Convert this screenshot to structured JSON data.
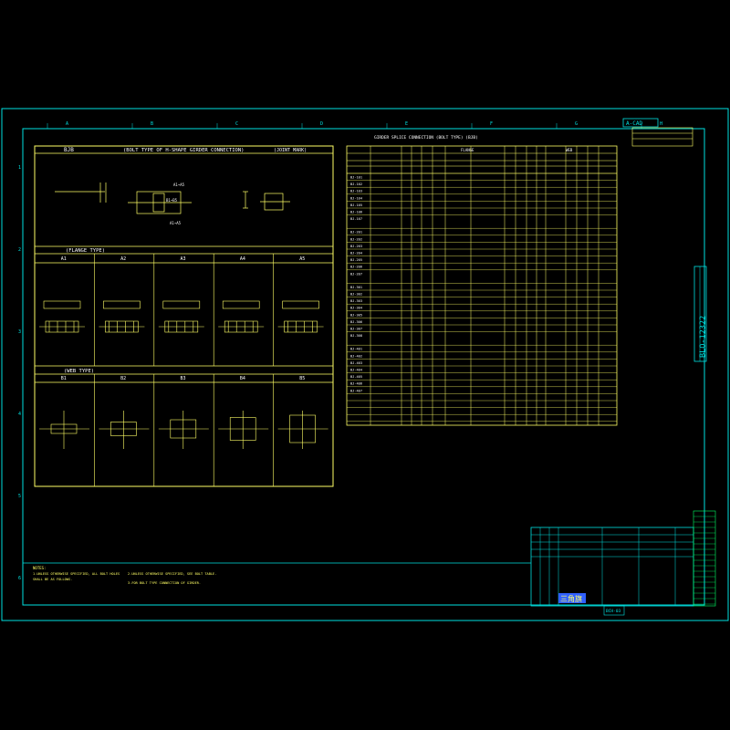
{
  "colors": {
    "background": "#000000",
    "frame": "#00e0e0",
    "drawing": "#ffff66",
    "white": "#ffffff",
    "green": "#00ff66",
    "magenta": "#ff00ff",
    "blue": "#3060ff"
  },
  "border": {
    "col_labels": [
      "A",
      "B",
      "C",
      "D",
      "E",
      "F",
      "G",
      "H"
    ],
    "row_labels": [
      "1",
      "2",
      "3",
      "4",
      "5",
      "6"
    ]
  },
  "left_sheet": {
    "header_code": "BJB",
    "header_title": "(BOLT TYPE OF H-SHAPE GIRDER CONNECTION)",
    "header_mark": "(JOINT MARK)",
    "flange_title": "(FLANGE TYPE)",
    "flange_cols": [
      "A1",
      "A2",
      "A3",
      "A4",
      "A5"
    ],
    "web_title": "(WEB TYPE)",
    "web_cols": [
      "B1",
      "B2",
      "B3",
      "B4",
      "B5"
    ],
    "callouts": [
      "A1~A5",
      "B1~B5",
      "A1~A5"
    ]
  },
  "table": {
    "title": "GIRDER SPLICE CONNECTION (BOLT TYPE) (BJB)",
    "group_headers": [
      "FLANGE",
      "WEB"
    ],
    "marks": [
      "BJ-101",
      "BJ-102",
      "BJ-103",
      "BJ-104",
      "BJ-105",
      "BJ-106",
      "BJ-107",
      "BJ-201",
      "BJ-202",
      "BJ-203",
      "BJ-204",
      "BJ-205",
      "BJ-206",
      "BJ-207",
      "BJ-301",
      "BJ-302",
      "BJ-303",
      "BJ-304",
      "BJ-305",
      "BJ-306",
      "BJ-307",
      "BJ-308",
      "BJ-401",
      "BJ-402",
      "BJ-403",
      "BJ-404",
      "BJ-405",
      "BJ-406",
      "BJ-407"
    ]
  },
  "title_block": {
    "top_label": "A-CAD",
    "drawing_no": "BLO-12322",
    "logo": "三角旗",
    "sheet_code": "BCH-03"
  },
  "notes": {
    "heading": "NOTES:",
    "line1": "1.UNLESS OTHERWISE SPECIFIED, ALL BOLT HOLES",
    "line2": "  SHALL BE AS FOLLOWS.",
    "line3": "2.UNLESS OTHERWISE SPECIFIED, SEE BOLT TABLE.",
    "line4": "3.FOR BOLT TYPE CONNECTION OF GIRDER."
  }
}
